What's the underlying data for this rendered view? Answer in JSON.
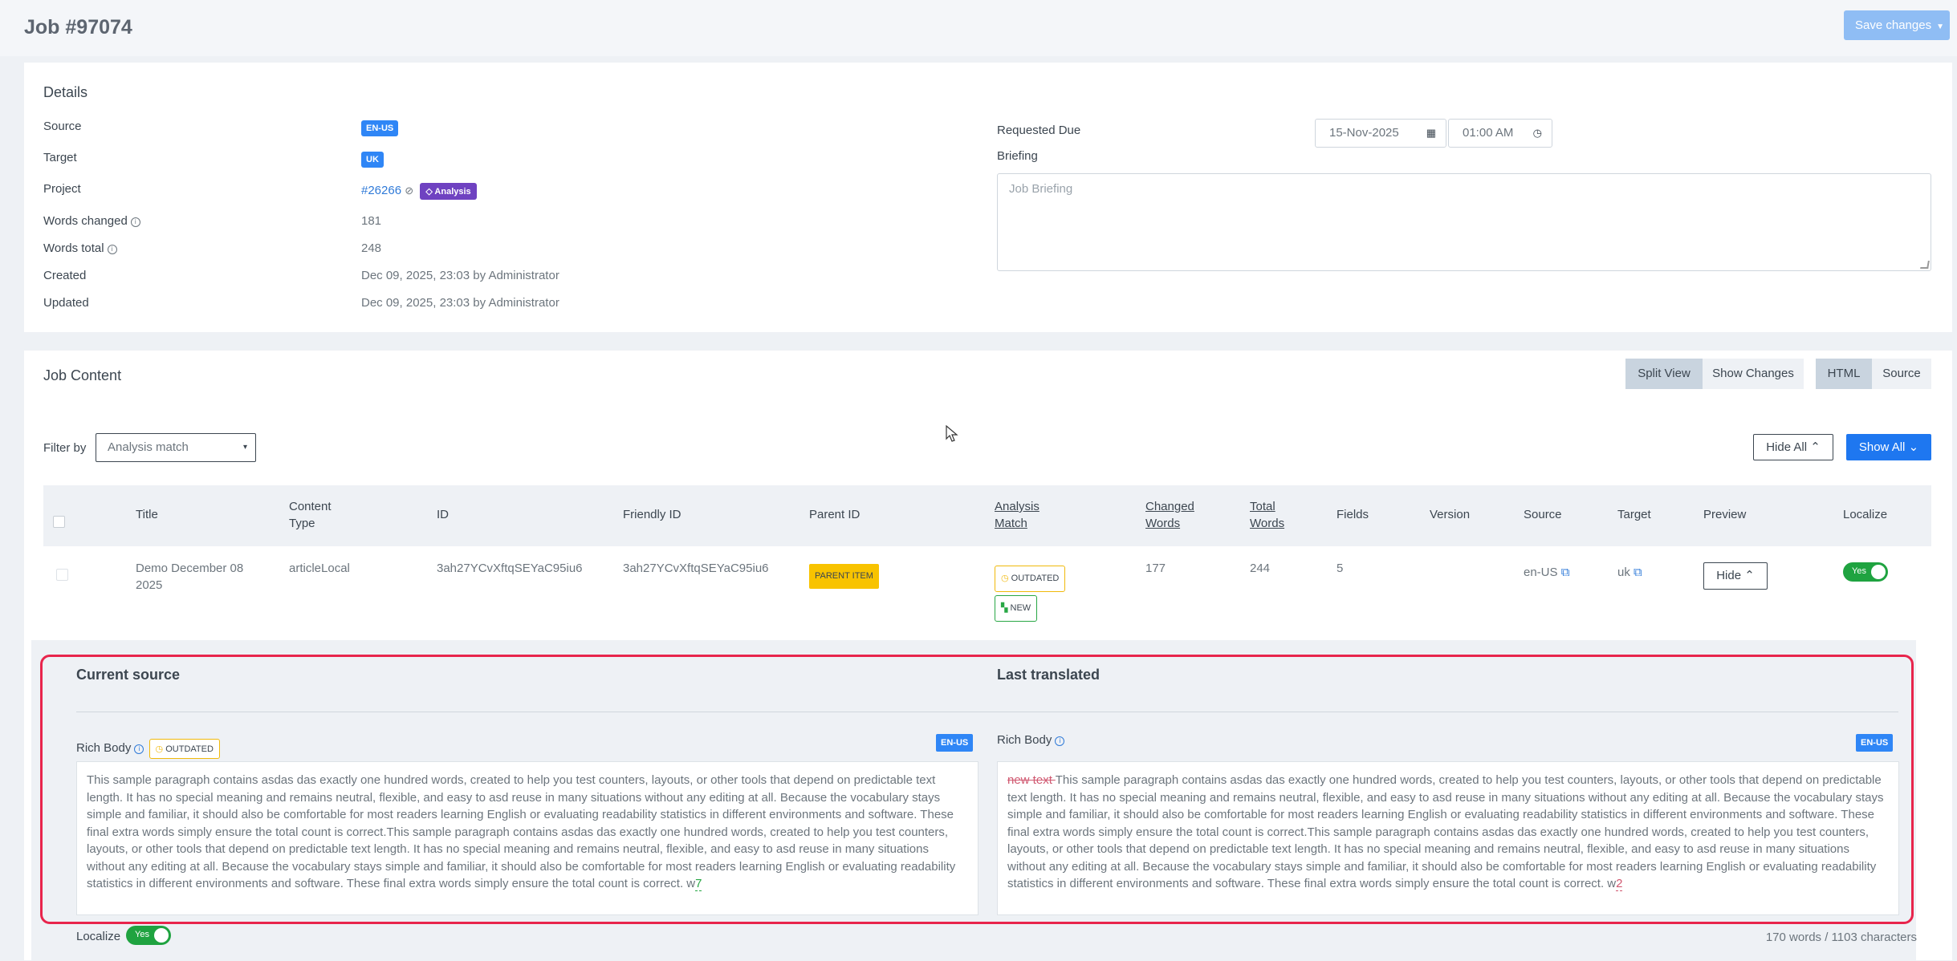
{
  "header": {
    "title": "Job #97074",
    "save_label": "Save changes"
  },
  "details": {
    "title": "Details",
    "source_label": "Source",
    "source_value": "EN-US",
    "target_label": "Target",
    "target_value": "UK",
    "project_label": "Project",
    "project_id": "#26266",
    "project_badge": "Analysis",
    "words_changed_label": "Words changed",
    "words_changed_value": "181",
    "words_total_label": "Words total",
    "words_total_value": "248",
    "created_label": "Created",
    "created_value": "Dec 09, 2025, 23:03 by Administrator",
    "updated_label": "Updated",
    "updated_value": "Dec 09, 2025, 23:03 by Administrator",
    "requested_due_label": "Requested Due",
    "due_date": "15-Nov-2025",
    "due_time": "01:00 AM",
    "briefing_label": "Briefing",
    "briefing_placeholder": "Job Briefing"
  },
  "content": {
    "title": "Job Content",
    "view_modes": [
      "Split View",
      "Show Changes"
    ],
    "format_modes": [
      "HTML",
      "Source"
    ],
    "filter_label": "Filter by",
    "filter_value": "Analysis match",
    "hide_all_label": "Hide All",
    "show_all_label": "Show All",
    "columns": {
      "title": "Title",
      "content_type_1": "Content",
      "content_type_2": "Type",
      "id": "ID",
      "friendly_id": "Friendly ID",
      "parent_id": "Parent ID",
      "analysis_1": "Analysis",
      "analysis_2": "Match",
      "changed_1": "Changed",
      "changed_2": "Words",
      "total_1": "Total",
      "total_2": "Words",
      "fields": "Fields",
      "version": "Version",
      "source": "Source",
      "target": "Target",
      "preview": "Preview",
      "localize": "Localize"
    },
    "row": {
      "title_line1": "Demo December 08",
      "title_line2": "2025",
      "content_type": "articleLocal",
      "id": "3ah27YCvXftqSEYaC95iu6",
      "friendly_id": "3ah27YCvXftqSEYaC95iu6",
      "parent_id": "PARENT ITEM",
      "match_outdated": "OUTDATED",
      "match_new": "NEW",
      "changed_words": "177",
      "total_words": "244",
      "fields": "5",
      "version": "",
      "source": "en-US",
      "target": "uk",
      "preview_label": "Hide",
      "localize_label": "Yes"
    }
  },
  "compare": {
    "current_title": "Current source",
    "last_title": "Last translated",
    "field_name": "Rich Body",
    "outdated_tag": "OUTDATED",
    "lang": "EN-US",
    "current_text": "This sample paragraph contains asdas das exactly one hundred words, created to help you test counters, layouts, or other tools that depend on predictable text length. It has no special meaning and remains neutral, flexible, and easy to asd reuse in many situations without any editing at all. Because the vocabulary stays simple and familiar, it should also be comfortable for most readers learning English or evaluating readability statistics in different environments and software. These final extra words simply ensure the total count is correct.This sample paragraph contains asdas das exactly one hundred words, created to help you test counters, layouts, or other tools that depend on predictable text length. It has no special meaning and remains neutral, flexible, and easy to asd reuse in many situations without any editing at all. Because the vocabulary stays simple and familiar, it should also be comfortable for most readers learning English or evaluating readability statistics in different environments and software. These final extra words simply ensure the total count is correct. w",
    "current_insert": "7",
    "last_deleted": "new text ",
    "last_text": "This sample paragraph contains asdas das exactly one hundred words, created to help you test counters, layouts, or other tools that depend on predictable text length. It has no special meaning and remains neutral, flexible, and easy to asd reuse in many situations without any editing at all. Because the vocabulary stays simple and familiar, it should also be comfortable for most readers learning English or evaluating readability statistics in different environments and software. These final extra words simply ensure the total count is correct.This sample paragraph contains asdas das exactly one hundred words, created to help you test counters, layouts, or other tools that depend on predictable text length. It has no special meaning and remains neutral, flexible, and easy to asd reuse in many situations without any editing at all. Because the vocabulary stays simple and familiar, it should also be comfortable for most readers learning English or evaluating readability statistics in different environments and software. These final extra words simply ensure the total count is correct. w",
    "last_insert": "2",
    "localize_label": "Localize",
    "localize_toggle": "Yes",
    "counter": "170 words / 1103 characters"
  },
  "colors": {
    "accent": "#1e77f0",
    "highlight_border": "#e8254c",
    "toggle_on": "#1fa340",
    "analysis_badge": "#6f42c1"
  }
}
